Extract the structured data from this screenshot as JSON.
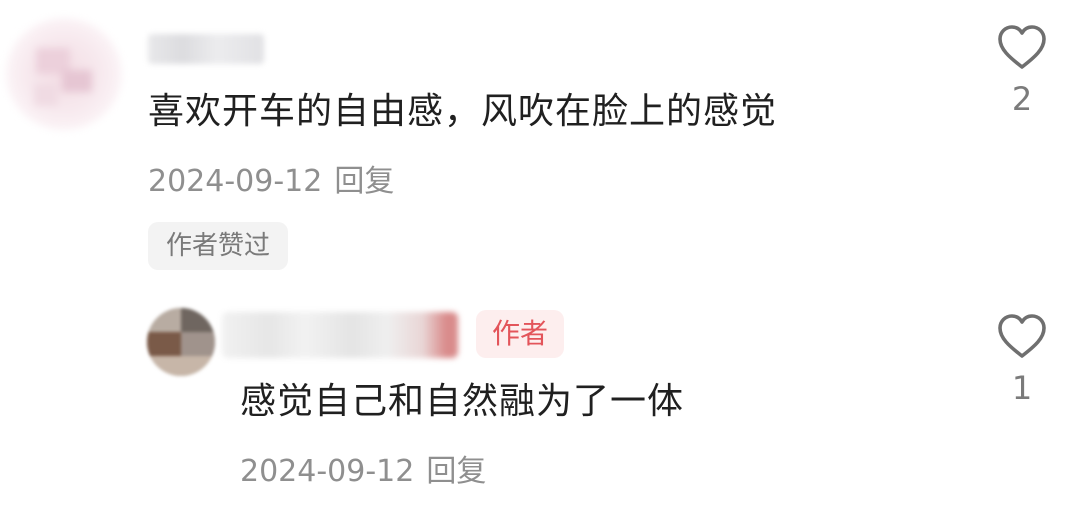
{
  "comment": {
    "username": "",
    "text": "喜欢开车的自由感，风吹在脸上的感觉",
    "date": "2024-09-12",
    "reply_label": "回复",
    "author_liked_label": "作者赞过",
    "like_count": "2",
    "like_icon": "heart-outline-icon"
  },
  "reply": {
    "username": "",
    "author_badge": "作者",
    "text": "感觉自己和自然融为了一体",
    "date": "2024-09-12",
    "reply_label": "回复",
    "like_count": "1",
    "like_icon": "heart-outline-icon"
  },
  "colors": {
    "text": "#202020",
    "meta": "#8f8f8f",
    "author_badge_bg": "#fdeeee",
    "author_badge_text": "#e3545a"
  }
}
